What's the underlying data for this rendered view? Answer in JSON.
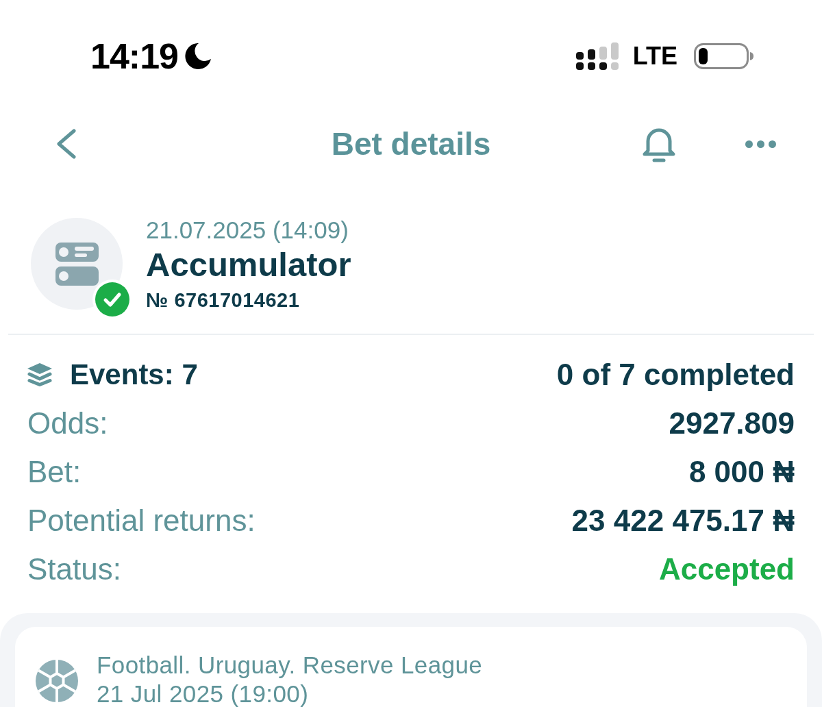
{
  "status_bar": {
    "time": "14:19",
    "network": "LTE"
  },
  "nav": {
    "title": "Bet details"
  },
  "bet": {
    "date": "21.07.2025 (14:09)",
    "type": "Accumulator",
    "number": "№ 67617014621",
    "accepted": true
  },
  "summary": [
    {
      "kind": "events",
      "label": "Events: 7",
      "value": "0 of 7 completed"
    },
    {
      "kind": "plain",
      "label": "Odds:",
      "value": "2927.809"
    },
    {
      "kind": "plain",
      "label": "Bet:",
      "value": "8 000 ₦"
    },
    {
      "kind": "plain",
      "label": "Potential returns:",
      "value": "23 422 475.17 ₦"
    },
    {
      "kind": "status",
      "label": "Status:",
      "value": "Accepted"
    }
  ],
  "events": [
    {
      "sport": "Football. Uruguay. Reserve League",
      "date": "21 Jul 2025 (19:00)"
    }
  ]
}
